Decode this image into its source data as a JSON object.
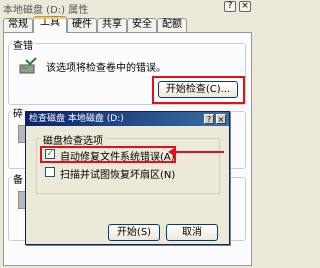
{
  "window": {
    "title": "本地磁盘 (D:) 属性",
    "help_glyph": "?",
    "close_glyph": "×"
  },
  "tabs": [
    {
      "label": "常规"
    },
    {
      "label": "工具"
    },
    {
      "label": "硬件"
    },
    {
      "label": "共享"
    },
    {
      "label": "安全"
    },
    {
      "label": "配额"
    }
  ],
  "error_check": {
    "group_label": "查错",
    "description": "该选项将检查卷中的错误。",
    "button_label": "开始检查(C)..."
  },
  "defrag_group": {
    "label_fragment": "碎"
  },
  "backup_group": {
    "label_fragment": "备"
  },
  "dialog": {
    "title": "检查磁盘 本地磁盘 (D:)",
    "help_glyph": "?",
    "close_glyph": "×",
    "options_label": "磁盘检查选项",
    "option1": {
      "label": "自动修复文件系统错误(A)",
      "checked": true,
      "mark": "✓"
    },
    "option2": {
      "label": "扫描并试图恢复坏扇区(N)",
      "checked": false
    },
    "start_button": "开始(S)",
    "cancel_button": "取消"
  },
  "highlight_color": "#e0101c"
}
